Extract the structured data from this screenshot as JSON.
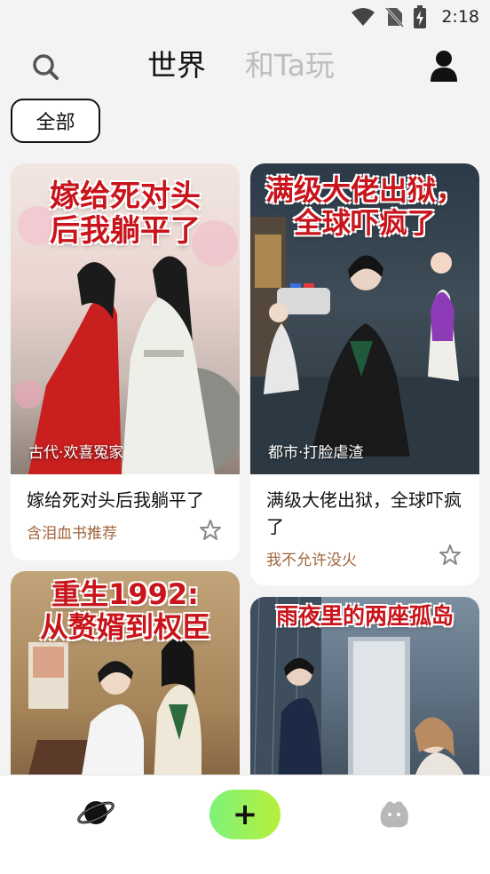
{
  "status_bar": {
    "time": "2:18",
    "icons": [
      "wifi-icon",
      "no-sim-icon",
      "battery-charging-icon"
    ]
  },
  "top_nav": {
    "tabs": [
      {
        "label": "世界",
        "active": true
      },
      {
        "label": "和Ta玩",
        "active": false
      }
    ],
    "icons": [
      "search-icon",
      "profile-icon"
    ]
  },
  "filter": {
    "label": "全部"
  },
  "cards": [
    {
      "cover_title": "嫁给死对头\n后我躺平了",
      "tag": "古代·欢喜冤家",
      "title": "嫁给死对头后我躺平了",
      "author": "含泪血书推荐"
    },
    {
      "cover_title": "满级大佬出狱，\n全球吓疯了",
      "tag": "都市·打脸虐渣",
      "title": "满级大佬出狱，全球吓疯了",
      "author": "我不允许没火"
    },
    {
      "cover_title": "重生1992:\n从赘婿到权臣",
      "tag": "",
      "title": "",
      "author": ""
    },
    {
      "cover_title": "雨夜里的两座孤岛",
      "tag": "",
      "title": "",
      "author": ""
    }
  ],
  "bottom_nav": {
    "items": [
      "planet-icon",
      "create-button",
      "slime-icon"
    ],
    "create_label": "+"
  },
  "colors": {
    "accent_green": "#8ef05a",
    "author_brown": "#a0653c",
    "cover_red": "#c8141a"
  }
}
